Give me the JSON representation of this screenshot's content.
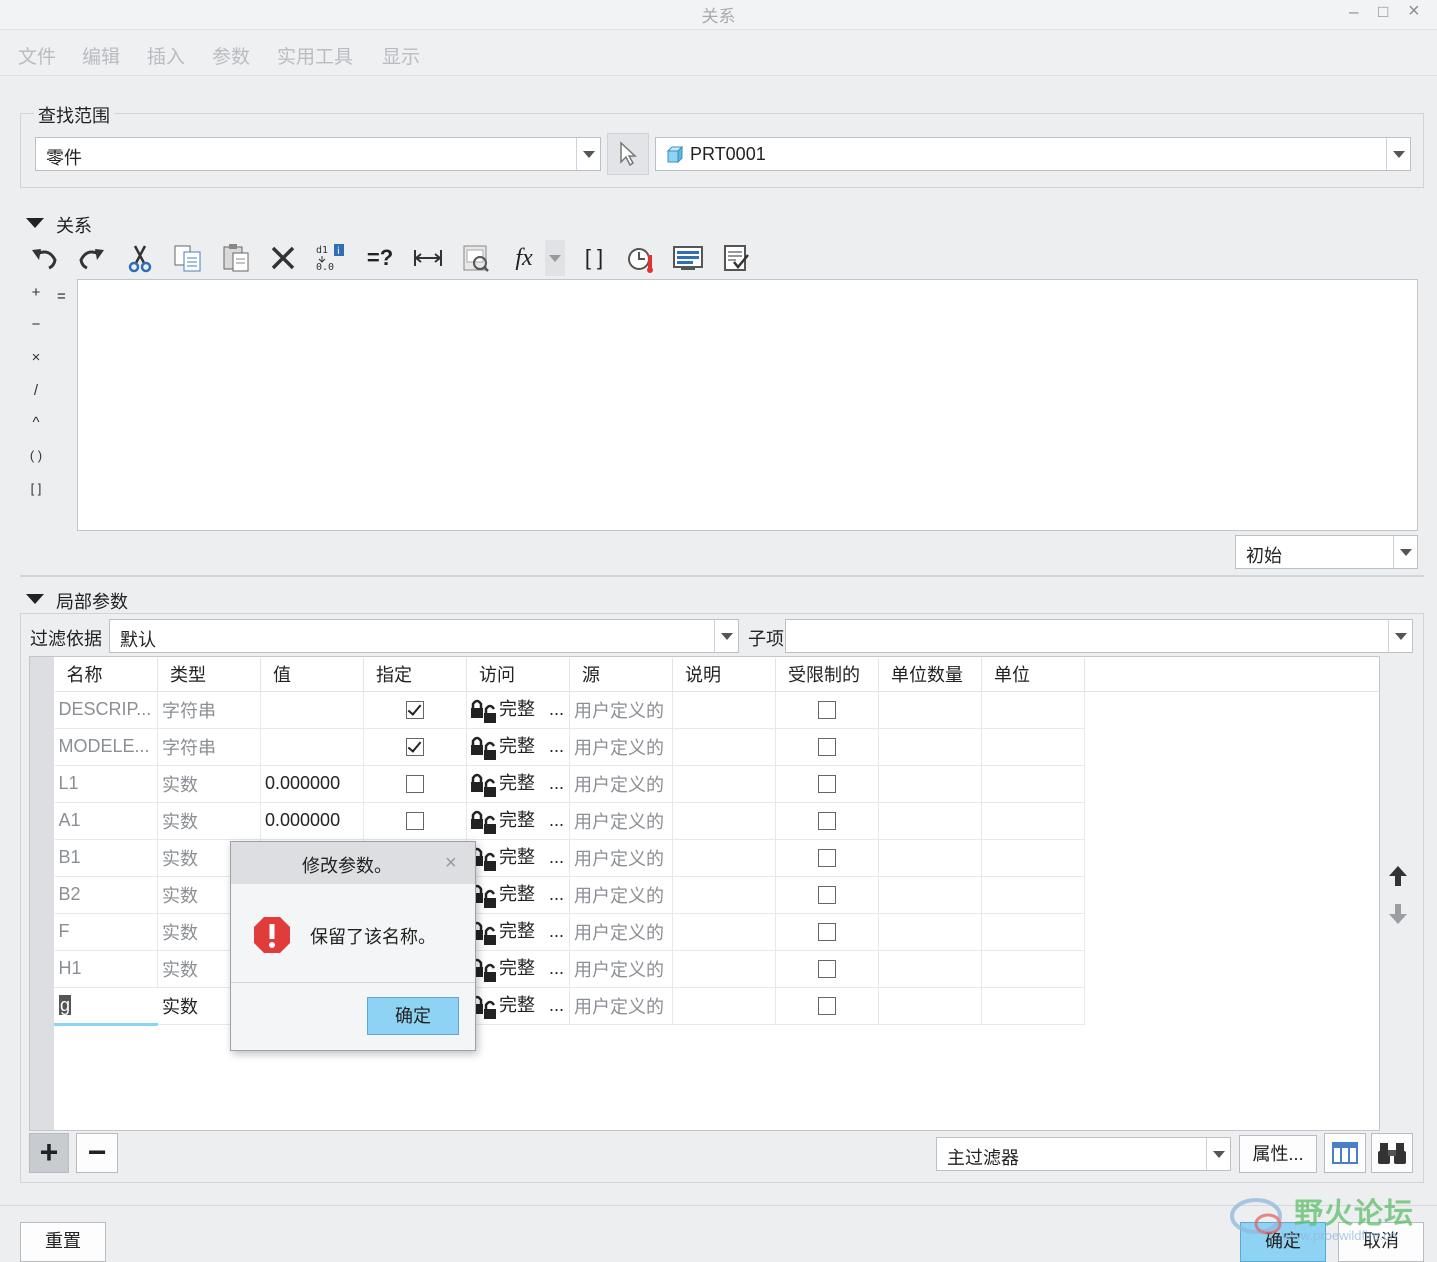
{
  "window": {
    "title": "关系",
    "minimize": "–",
    "maximize": "□",
    "close": "×"
  },
  "menubar": [
    "文件",
    "编辑",
    "插入",
    "参数",
    "实用工具",
    "显示"
  ],
  "search_scope": {
    "legend": "查找范围",
    "scope_value": "零件",
    "model_value": "PRT0001"
  },
  "relations": {
    "section_label": "关系",
    "editor_text": "",
    "ops": [
      "+",
      "−",
      "×",
      "/",
      "^",
      "( )",
      "[ ]"
    ],
    "eq_label": "=",
    "mode_value": "初始",
    "toolbar": [
      "undo-icon",
      "redo-icon",
      "cut-icon",
      "copy-icon",
      "paste-icon",
      "delete-icon",
      "dimension-values-icon",
      "evaluate-icon",
      "show-dimension-icon",
      "sort-relations-icon",
      "function-icon",
      "brackets-icon",
      "check-units-icon",
      "verify-icon",
      "settings-icon"
    ],
    "toolbar_text": {
      "fx": "fx",
      "brackets": "[ ]",
      "eval": "=?"
    }
  },
  "local_params": {
    "section_label": "局部参数",
    "filter_label": "过滤依据",
    "filter_value": "默认",
    "child_label": "子项",
    "child_value": "",
    "columns": [
      "名称",
      "类型",
      "值",
      "指定",
      "访问",
      "源",
      "说明",
      "受限制的",
      "单位数量",
      "单位"
    ],
    "rows": [
      {
        "name": "DESCRIP...",
        "type": "字符串",
        "value": "",
        "designate": true,
        "access": "完整",
        "source": "用户定义的",
        "restricted": false
      },
      {
        "name": "MODELE...",
        "type": "字符串",
        "value": "",
        "designate": true,
        "access": "完整",
        "source": "用户定义的",
        "restricted": false
      },
      {
        "name": "L1",
        "type": "实数",
        "value": "0.000000",
        "designate": false,
        "access": "完整",
        "source": "用户定义的",
        "restricted": false
      },
      {
        "name": "A1",
        "type": "实数",
        "value": "0.000000",
        "designate": false,
        "access": "完整",
        "source": "用户定义的",
        "restricted": false
      },
      {
        "name": "B1",
        "type": "实数",
        "value": "",
        "designate": false,
        "access": "完整",
        "source": "用户定义的",
        "restricted": false
      },
      {
        "name": "B2",
        "type": "实数",
        "value": "",
        "designate": false,
        "access": "完整",
        "source": "用户定义的",
        "restricted": false
      },
      {
        "name": "F",
        "type": "实数",
        "value": "",
        "designate": false,
        "access": "完整",
        "source": "用户定义的",
        "restricted": false
      },
      {
        "name": "H1",
        "type": "实数",
        "value": "",
        "designate": false,
        "access": "完整",
        "source": "用户定义的",
        "restricted": false
      },
      {
        "name": "g",
        "type": "实数",
        "value": "",
        "designate": false,
        "access": "完整",
        "source": "用户定义的",
        "restricted": false
      }
    ],
    "access_ellipsis": "...",
    "add_label": "+",
    "remove_label": "−",
    "main_filter": "主过滤器",
    "properties_button": "属性..."
  },
  "dialog": {
    "title": "修改参数。",
    "message": "保留了该名称。",
    "ok_label": "确定",
    "close_label": "×"
  },
  "footer": {
    "reset_label": "重置",
    "ok_label": "确定",
    "cancel_label": "取消"
  },
  "watermark": {
    "brand": "野火论坛",
    "url": "www.proewildfire.cn"
  },
  "colors": {
    "accent": "#8fd3f4",
    "error": "#e03c3c"
  }
}
